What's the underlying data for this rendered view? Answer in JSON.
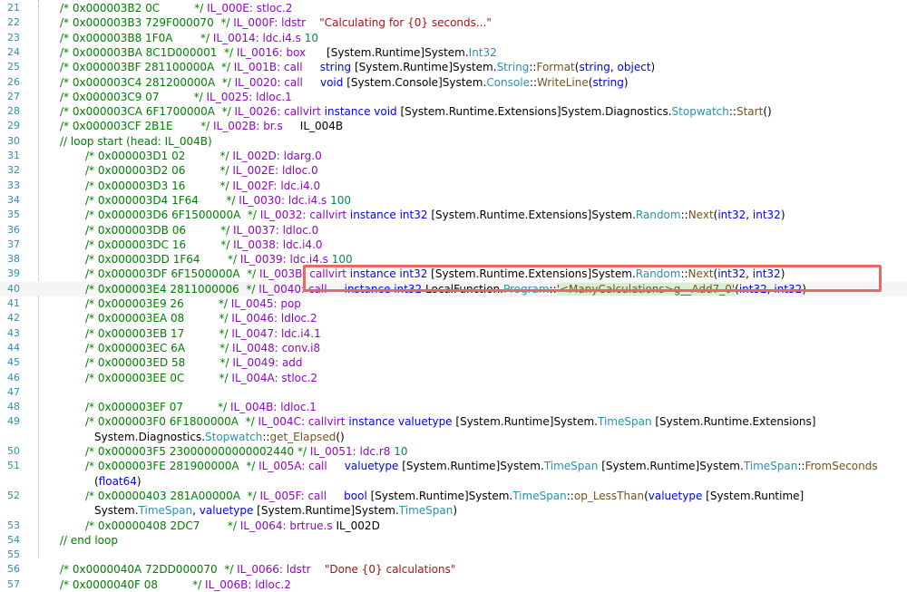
{
  "colors": {
    "keyword": "#0000ff",
    "comment": "#008000",
    "string": "#a31515",
    "type": "#2b91af",
    "method": "#74531f",
    "highlight_box": "#e8686a"
  },
  "lines": [
    {
      "n": "21",
      "indent": 1,
      "offset": "0x000003B2",
      "bytes": "0C",
      "il": "IL_000E",
      "op": "stloc.2",
      "arg": []
    },
    {
      "n": "22",
      "indent": 1,
      "offset": "0x000003B3",
      "bytes": "729F000070",
      "il": "IL_000F",
      "op": "ldstr",
      "arg": [
        {
          "t": "\"Calculating for {0} seconds...\"",
          "c": "s"
        }
      ]
    },
    {
      "n": "23",
      "indent": 1,
      "offset": "0x000003B8",
      "bytes": "1F0A",
      "il": "IL_0014",
      "op": "ldc.i4.s",
      "arg": [
        {
          "t": "10",
          "c": "n"
        }
      ]
    },
    {
      "n": "24",
      "indent": 1,
      "offset": "0x000003BA",
      "bytes": "8C1D000001",
      "il": "IL_0016",
      "op": "box",
      "arg": [
        {
          "t": "[System.Runtime]",
          "c": ""
        },
        {
          "t": "System.",
          "c": ""
        },
        {
          "t": "Int32",
          "c": "t"
        }
      ]
    },
    {
      "n": "25",
      "indent": 1,
      "offset": "0x000003BF",
      "bytes": "281100000A",
      "il": "IL_001B",
      "op": "call",
      "arg": [
        {
          "t": "string ",
          "c": "k"
        },
        {
          "t": "[System.Runtime]",
          "c": ""
        },
        {
          "t": "System.",
          "c": ""
        },
        {
          "t": "String",
          "c": "t"
        },
        {
          "t": "::",
          "c": ""
        },
        {
          "t": "Format",
          "c": "m"
        },
        {
          "t": "(",
          "c": ""
        },
        {
          "t": "string",
          "c": "k"
        },
        {
          "t": ", ",
          "c": ""
        },
        {
          "t": "object",
          "c": "k"
        },
        {
          "t": ")",
          "c": ""
        }
      ]
    },
    {
      "n": "26",
      "indent": 1,
      "offset": "0x000003C4",
      "bytes": "281200000A",
      "il": "IL_0020",
      "op": "call",
      "arg": [
        {
          "t": "void ",
          "c": "k"
        },
        {
          "t": "[System.Console]",
          "c": ""
        },
        {
          "t": "System.",
          "c": ""
        },
        {
          "t": "Console",
          "c": "t"
        },
        {
          "t": "::",
          "c": ""
        },
        {
          "t": "WriteLine",
          "c": "m"
        },
        {
          "t": "(",
          "c": ""
        },
        {
          "t": "string",
          "c": "k"
        },
        {
          "t": ")",
          "c": ""
        }
      ]
    },
    {
      "n": "27",
      "indent": 1,
      "offset": "0x000003C9",
      "bytes": "07",
      "il": "IL_0025",
      "op": "ldloc.1",
      "arg": []
    },
    {
      "n": "28",
      "indent": 1,
      "offset": "0x000003CA",
      "bytes": "6F1700000A",
      "il": "IL_0026",
      "op": "callvirt",
      "arg": [
        {
          "t": "instance void ",
          "c": "k"
        },
        {
          "t": "[System.Runtime.Extensions]",
          "c": ""
        },
        {
          "t": "System.Diagnostics.",
          "c": ""
        },
        {
          "t": "Stopwatch",
          "c": "t"
        },
        {
          "t": "::",
          "c": ""
        },
        {
          "t": "Start",
          "c": "m"
        },
        {
          "t": "()",
          "c": ""
        }
      ]
    },
    {
      "n": "29",
      "indent": 1,
      "offset": "0x000003CF",
      "bytes": "2B1E",
      "il": "IL_002B",
      "op": "br.s",
      "arg": [
        {
          "t": "IL_004B",
          "c": ""
        }
      ]
    },
    {
      "n": "30",
      "indent": 1,
      "raw": "// loop start (head: IL_004B)"
    },
    {
      "n": "31",
      "indent": 2,
      "offset": "0x000003D1",
      "bytes": "02",
      "il": "IL_002D",
      "op": "ldarg.0",
      "arg": []
    },
    {
      "n": "32",
      "indent": 2,
      "offset": "0x000003D2",
      "bytes": "06",
      "il": "IL_002E",
      "op": "ldloc.0",
      "arg": []
    },
    {
      "n": "33",
      "indent": 2,
      "offset": "0x000003D3",
      "bytes": "16",
      "il": "IL_002F",
      "op": "ldc.i4.0",
      "arg": []
    },
    {
      "n": "34",
      "indent": 2,
      "offset": "0x000003D4",
      "bytes": "1F64",
      "il": "IL_0030",
      "op": "ldc.i4.s",
      "arg": [
        {
          "t": "100",
          "c": "n"
        }
      ]
    },
    {
      "n": "35",
      "indent": 2,
      "offset": "0x000003D6",
      "bytes": "6F1500000A",
      "il": "IL_0032",
      "op": "callvirt",
      "arg": [
        {
          "t": "instance int32 ",
          "c": "k"
        },
        {
          "t": "[System.Runtime.Extensions]",
          "c": ""
        },
        {
          "t": "System.",
          "c": ""
        },
        {
          "t": "Random",
          "c": "t"
        },
        {
          "t": "::",
          "c": ""
        },
        {
          "t": "Next",
          "c": "m"
        },
        {
          "t": "(",
          "c": ""
        },
        {
          "t": "int32",
          "c": "k"
        },
        {
          "t": ", ",
          "c": ""
        },
        {
          "t": "int32",
          "c": "k"
        },
        {
          "t": ")",
          "c": ""
        }
      ]
    },
    {
      "n": "36",
      "indent": 2,
      "offset": "0x000003DB",
      "bytes": "06",
      "il": "IL_0037",
      "op": "ldloc.0",
      "arg": []
    },
    {
      "n": "37",
      "indent": 2,
      "offset": "0x000003DC",
      "bytes": "16",
      "il": "IL_0038",
      "op": "ldc.i4.0",
      "arg": []
    },
    {
      "n": "38",
      "indent": 2,
      "offset": "0x000003DD",
      "bytes": "1F64",
      "il": "IL_0039",
      "op": "ldc.i4.s",
      "arg": [
        {
          "t": "100",
          "c": "n"
        }
      ]
    },
    {
      "n": "39",
      "indent": 2,
      "offset": "0x000003DF",
      "bytes": "6F1500000A",
      "il": "IL_003B",
      "op": "callvirt",
      "arg": [
        {
          "t": "instance int32 ",
          "c": "k"
        },
        {
          "t": "[System.Runtime.Extensions]",
          "c": ""
        },
        {
          "t": "System.",
          "c": ""
        },
        {
          "t": "Random",
          "c": "t"
        },
        {
          "t": "::",
          "c": ""
        },
        {
          "t": "Next",
          "c": "m"
        },
        {
          "t": "(",
          "c": ""
        },
        {
          "t": "int32",
          "c": "k"
        },
        {
          "t": ", ",
          "c": ""
        },
        {
          "t": "int32",
          "c": "k"
        },
        {
          "t": ")",
          "c": ""
        }
      ]
    },
    {
      "n": "40",
      "indent": 2,
      "current": true,
      "offset": "0x000003E4",
      "bytes": "2811000006",
      "il": "IL_0040",
      "op": "call",
      "arg": [
        {
          "t": "instance int32 ",
          "c": "k"
        },
        {
          "t": "LocalFunction.",
          "c": ""
        },
        {
          "t": "Program",
          "c": "t"
        },
        {
          "t": "::",
          "c": ""
        },
        {
          "t": "'<ManyCalculations>g__Add7_0'",
          "c": "mh"
        },
        {
          "t": "(",
          "c": ""
        },
        {
          "t": "int32",
          "c": "k"
        },
        {
          "t": ", ",
          "c": ""
        },
        {
          "t": "int32",
          "c": "k"
        },
        {
          "t": ")",
          "c": ""
        }
      ]
    },
    {
      "n": "41",
      "indent": 2,
      "offset": "0x000003E9",
      "bytes": "26",
      "il": "IL_0045",
      "op": "pop",
      "arg": []
    },
    {
      "n": "42",
      "indent": 2,
      "offset": "0x000003EA",
      "bytes": "08",
      "il": "IL_0046",
      "op": "ldloc.2",
      "arg": []
    },
    {
      "n": "43",
      "indent": 2,
      "offset": "0x000003EB",
      "bytes": "17",
      "il": "IL_0047",
      "op": "ldc.i4.1",
      "arg": []
    },
    {
      "n": "44",
      "indent": 2,
      "offset": "0x000003EC",
      "bytes": "6A",
      "il": "IL_0048",
      "op": "conv.i8",
      "arg": []
    },
    {
      "n": "45",
      "indent": 2,
      "offset": "0x000003ED",
      "bytes": "58",
      "il": "IL_0049",
      "op": "add",
      "arg": []
    },
    {
      "n": "46",
      "indent": 2,
      "offset": "0x000003EE",
      "bytes": "0C",
      "il": "IL_004A",
      "op": "stloc.2",
      "arg": []
    },
    {
      "n": "47",
      "indent": 2,
      "raw": ""
    },
    {
      "n": "48",
      "indent": 2,
      "offset": "0x000003EF",
      "bytes": "07",
      "il": "IL_004B",
      "op": "ldloc.1",
      "arg": []
    },
    {
      "n": "49",
      "indent": 2,
      "offset": "0x000003F0",
      "bytes": "6F1800000A",
      "il": "IL_004C",
      "op": "callvirt",
      "arg": [
        {
          "t": "instance valuetype ",
          "c": "k"
        },
        {
          "t": "[System.Runtime]",
          "c": ""
        },
        {
          "t": "System.",
          "c": ""
        },
        {
          "t": "TimeSpan",
          "c": "t"
        },
        {
          "t": " [System.Runtime.Extensions]",
          "c": ""
        }
      ]
    },
    {
      "n": "",
      "indent": 3,
      "cont": [
        {
          "t": "System.Diagnostics.",
          "c": ""
        },
        {
          "t": "Stopwatch",
          "c": "t"
        },
        {
          "t": "::",
          "c": ""
        },
        {
          "t": "get_Elapsed",
          "c": "m"
        },
        {
          "t": "()",
          "c": ""
        }
      ]
    },
    {
      "n": "50",
      "indent": 2,
      "offset": "0x000003F5",
      "bytes": "230000000000002440",
      "il": "IL_0051",
      "op": "ldc.r8",
      "arg": [
        {
          "t": "10",
          "c": "n"
        }
      ],
      "tight": true
    },
    {
      "n": "51",
      "indent": 2,
      "offset": "0x000003FE",
      "bytes": "281900000A",
      "il": "IL_005A",
      "op": "call",
      "arg": [
        {
          "t": "valuetype ",
          "c": "k"
        },
        {
          "t": "[System.Runtime]",
          "c": ""
        },
        {
          "t": "System.",
          "c": ""
        },
        {
          "t": "TimeSpan",
          "c": "t"
        },
        {
          "t": " [System.Runtime]",
          "c": ""
        },
        {
          "t": "System.",
          "c": ""
        },
        {
          "t": "TimeSpan",
          "c": "t"
        },
        {
          "t": "::",
          "c": ""
        },
        {
          "t": "FromSeconds",
          "c": "m"
        }
      ]
    },
    {
      "n": "",
      "indent": 3,
      "cont": [
        {
          "t": "(",
          "c": ""
        },
        {
          "t": "float64",
          "c": "k"
        },
        {
          "t": ")",
          "c": ""
        }
      ]
    },
    {
      "n": "52",
      "indent": 2,
      "offset": "0x00000403",
      "bytes": "281A00000A",
      "il": "IL_005F",
      "op": "call",
      "arg": [
        {
          "t": "bool ",
          "c": "k"
        },
        {
          "t": "[System.Runtime]",
          "c": ""
        },
        {
          "t": "System.",
          "c": ""
        },
        {
          "t": "TimeSpan",
          "c": "t"
        },
        {
          "t": "::",
          "c": ""
        },
        {
          "t": "op_LessThan",
          "c": "m"
        },
        {
          "t": "(",
          "c": ""
        },
        {
          "t": "valuetype ",
          "c": "k"
        },
        {
          "t": "[System.Runtime]",
          "c": ""
        }
      ]
    },
    {
      "n": "",
      "indent": 3,
      "cont": [
        {
          "t": "System.",
          "c": ""
        },
        {
          "t": "TimeSpan",
          "c": "t"
        },
        {
          "t": ", ",
          "c": ""
        },
        {
          "t": "valuetype ",
          "c": "k"
        },
        {
          "t": "[System.Runtime]",
          "c": ""
        },
        {
          "t": "System.",
          "c": ""
        },
        {
          "t": "TimeSpan",
          "c": "t"
        },
        {
          "t": ")",
          "c": ""
        }
      ]
    },
    {
      "n": "53",
      "indent": 2,
      "offset": "0x00000408",
      "bytes": "2DC7",
      "il": "IL_0064",
      "op": "brtrue.s",
      "arg": [
        {
          "t": "IL_002D",
          "c": ""
        }
      ]
    },
    {
      "n": "54",
      "indent": 1,
      "raw": "// end loop"
    },
    {
      "n": "55",
      "indent": 1,
      "raw": ""
    },
    {
      "n": "56",
      "indent": 1,
      "offset": "0x0000040A",
      "bytes": "72DD000070",
      "il": "IL_0066",
      "op": "ldstr",
      "arg": [
        {
          "t": "\"Done {0} calculations\"",
          "c": "s"
        }
      ]
    },
    {
      "n": "57",
      "indent": 1,
      "offset": "0x0000040F",
      "bytes": "08",
      "il": "IL_006B",
      "op": "ldloc.2",
      "arg": []
    }
  ]
}
